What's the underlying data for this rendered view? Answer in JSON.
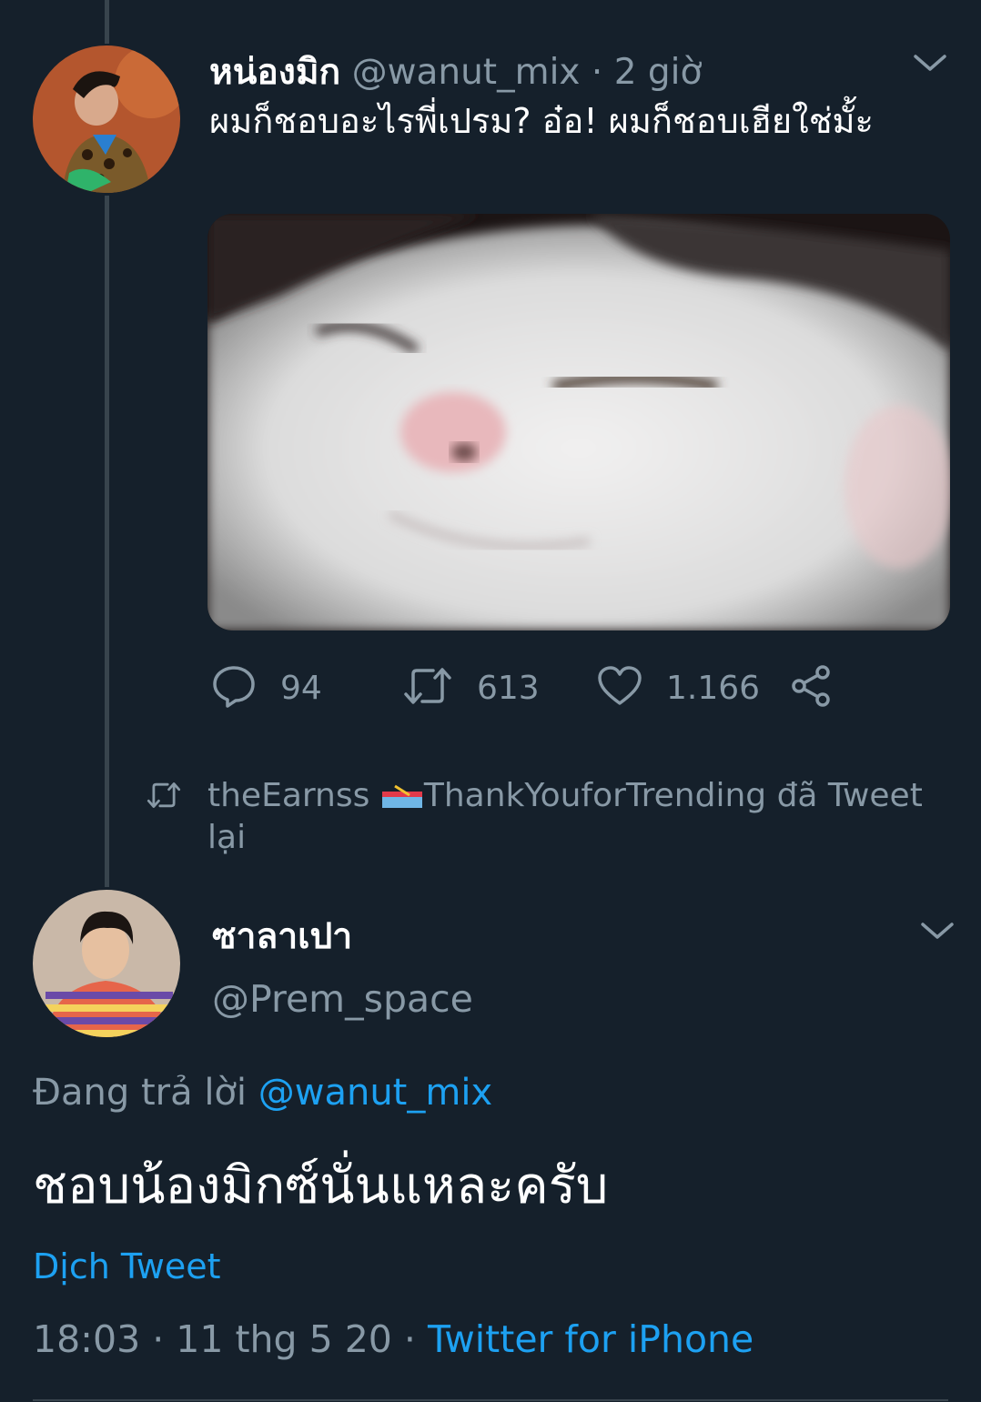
{
  "tweet1": {
    "display_name": "หน่องมิก",
    "handle": "@wanut_mix",
    "separator": "·",
    "time_ago": "2 giờ",
    "text": "ผมก็ชอบอะไรพี่เปรม? อ๋อ! ผมก็ชอบเฮียใช่มั้ะ",
    "actions": {
      "replies": "94",
      "retweets": "613",
      "likes": "1.166"
    }
  },
  "retweet_note": {
    "user": "theEarnss",
    "suffix": "ThankYouforTrending đã Tweet lại"
  },
  "tweet2": {
    "display_name": "ซาลาเปา",
    "handle": "@Prem_space",
    "replying_label": "Đang trả lời",
    "replying_to": "@wanut_mix",
    "text": "ชอบน้องมิกซ์นั่นแหละครับ",
    "translate_label": "Dịch Tweet",
    "timestamp": "18:03 · 11 thg 5 20 ·",
    "source": "Twitter for iPhone"
  },
  "icons": {
    "reply": "reply-icon",
    "retweet": "retweet-icon",
    "like": "heart-icon",
    "share": "share-icon",
    "menu": "chevron-down-icon"
  },
  "colors": {
    "background": "#15202b",
    "muted": "#8899a6",
    "link": "#1da1f2",
    "thread_line": "#38444d"
  }
}
